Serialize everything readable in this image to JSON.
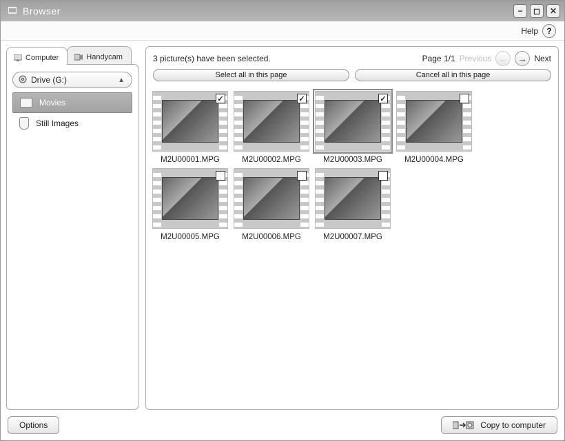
{
  "window": {
    "title": "Browser"
  },
  "help": {
    "label": "Help"
  },
  "sidebar": {
    "tabs": [
      {
        "label": "Computer",
        "active": true
      },
      {
        "label": "Handycam",
        "active": false
      }
    ],
    "drive_label": "Drive (G:)",
    "categories": [
      {
        "label": "Movies",
        "selected": true
      },
      {
        "label": "Still Images",
        "selected": false
      }
    ]
  },
  "content": {
    "selection_status": "3 picture(s) have been selected.",
    "page_label": "Page 1/1",
    "prev_label": "Previous",
    "next_label": "Next",
    "select_all_label": "Select all in this page",
    "cancel_all_label": "Cancel all in this page",
    "thumbnails": [
      {
        "filename": "M2U00001.MPG",
        "checked": true,
        "current": false
      },
      {
        "filename": "M2U00002.MPG",
        "checked": true,
        "current": false
      },
      {
        "filename": "M2U00003.MPG",
        "checked": true,
        "current": true
      },
      {
        "filename": "M2U00004.MPG",
        "checked": false,
        "current": false
      },
      {
        "filename": "M2U00005.MPG",
        "checked": false,
        "current": false
      },
      {
        "filename": "M2U00006.MPG",
        "checked": false,
        "current": false
      },
      {
        "filename": "M2U00007.MPG",
        "checked": false,
        "current": false
      }
    ]
  },
  "footer": {
    "options_label": "Options",
    "copy_label": "Copy to computer"
  }
}
